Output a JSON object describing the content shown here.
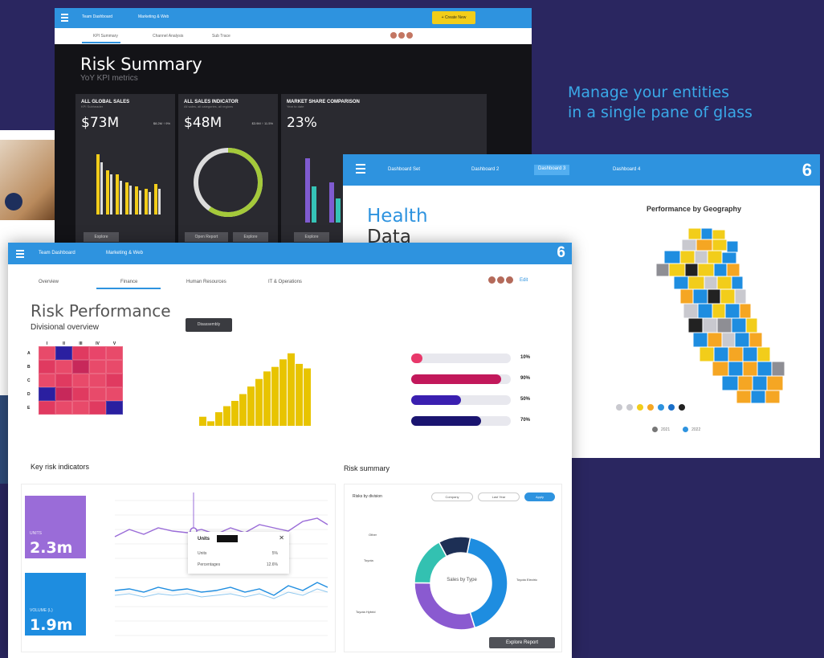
{
  "tagline": [
    "Manage your entities",
    "in a single pane of glass"
  ],
  "dark_window": {
    "nav": [
      "Team Dashboard",
      "Marketing & Web"
    ],
    "create_label": "+ Create New",
    "tabs": [
      "KPI Summary",
      "Channel Analysis",
      "Sub Trace"
    ],
    "title": "Risk Summary",
    "subtitle": "YoY KPI metrics",
    "cards": [
      {
        "header": "ALL GLOBAL SALES",
        "sub": "KPI Subheader",
        "value": "$73M",
        "side": "$8.2M ↑ 9%",
        "button": "Explore"
      },
      {
        "header": "ALL SALES INDICATOR",
        "sub": "All sales, all categories, all regions",
        "value": "$48M",
        "side": "$3.9M ↑ 11.5%",
        "button": "Open Report",
        "button2": "Explore"
      },
      {
        "header": "MARKET SHARE COMPARISON",
        "sub": "Year to date",
        "value": "23%",
        "button": "Explore"
      }
    ],
    "accent_colors": {
      "yellow": "#f2cd1a",
      "green": "#a4c93a",
      "purple": "#7f5bd0",
      "teal": "#35c4b6"
    }
  },
  "health_window": {
    "nav": [
      "Dashboard Set",
      "Dashboard 2",
      "Dashboard 3",
      "Dashboard 4"
    ],
    "logo": "6",
    "title_line1": "Health",
    "title_line2": "Data",
    "geo_title": "Performance by Geography",
    "legend_dot_colors": [
      "#c9c9cf",
      "#f2cd1a",
      "#f5a623",
      "#2e93df",
      "#1a6fc9",
      "#222222"
    ],
    "legend2": [
      "2021",
      "2022"
    ]
  },
  "main_window": {
    "nav": [
      "Team Dashboard",
      "Marketing & Web"
    ],
    "logo": "6",
    "tabs": [
      "Overview",
      "Finance",
      "Human Resources",
      "IT & Operations"
    ],
    "edit_label": "Edit",
    "title": "Risk Performance",
    "subtitle": "Divisional overview",
    "display_button": "Disassembly",
    "heatmap": {
      "cols": [
        "I",
        "II",
        "III",
        "IV",
        "V"
      ],
      "rows": [
        "A",
        "B",
        "C",
        "D",
        "E"
      ],
      "colors": [
        [
          "#e84a6a",
          "#2a1fa0",
          "#e03a60",
          "#e8456a",
          "#e84a6a"
        ],
        [
          "#e03a60",
          "#e84a6a",
          "#c7285a",
          "#e84a6a",
          "#e84a6a"
        ],
        [
          "#e84a6a",
          "#e03a60",
          "#e84a6a",
          "#e84a6a",
          "#e03a60"
        ],
        [
          "#2a1fa0",
          "#c7285a",
          "#e03a60",
          "#e84a6a",
          "#e84a6a"
        ],
        [
          "#e03a60",
          "#e84a6a",
          "#e84a6a",
          "#e03a60",
          "#2a1fa0"
        ]
      ]
    },
    "bar_values": [
      12,
      6,
      18,
      26,
      33,
      42,
      52,
      62,
      72,
      78,
      88,
      96,
      82,
      76
    ],
    "progress": [
      {
        "pct_label": "10%",
        "value": 0.1,
        "color": "#e8386a"
      },
      {
        "pct_label": "90%",
        "value": 0.9,
        "color": "#c2185b"
      },
      {
        "pct_label": "50%",
        "value": 0.5,
        "color": "#3a1fb0"
      },
      {
        "pct_label": "70%",
        "value": 0.7,
        "color": "#1a1470"
      }
    ],
    "kri_title": "Key risk indicators",
    "kri_tiles": [
      {
        "label": "UNITS",
        "value": "2.3m",
        "color": "#9a6cd8"
      },
      {
        "label": "VOLUME (L)",
        "value": "1.9m",
        "color": "#1e8de0"
      }
    ],
    "tooltip": {
      "header": "Units",
      "rows": [
        [
          "Units",
          "5%"
        ],
        [
          "Percentages",
          "12.6%"
        ]
      ]
    },
    "risk_summary": {
      "title": "Risk summary",
      "label": "Risks by division",
      "filters": [
        "Company",
        "Last Year"
      ],
      "apply": "Apply",
      "center_label": "Sales by Type",
      "callouts": [
        "Other",
        "Toyota",
        "Toyota Hybrid",
        "Toyota Electric"
      ],
      "explore": "Explore Report",
      "slices": [
        {
          "name": "Toyota Electric",
          "value": 42,
          "color": "#1e8de0"
        },
        {
          "name": "Toyota Hybrid",
          "value": 30,
          "color": "#8a5ad0"
        },
        {
          "name": "Toyota",
          "value": 17,
          "color": "#33c1b1"
        },
        {
          "name": "Other",
          "value": 11,
          "color": "#1d2f55"
        }
      ]
    }
  }
}
